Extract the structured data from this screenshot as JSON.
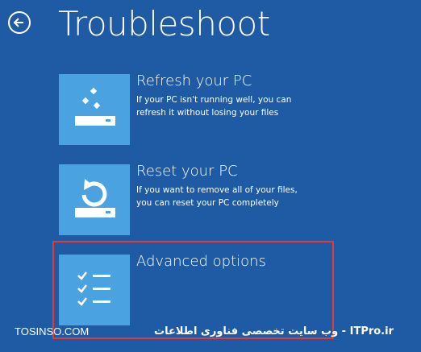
{
  "header": {
    "title": "Troubleshoot",
    "back_icon": "back-arrow-icon"
  },
  "options": [
    {
      "title": "Refresh your PC",
      "description": "If your PC isn't running well, you can refresh it without losing your files",
      "icon": "refresh-pc-icon"
    },
    {
      "title": "Reset your PC",
      "description": "If you want to remove all of your files, you can reset your PC completely",
      "icon": "reset-pc-icon"
    },
    {
      "title": "Advanced options",
      "description": "",
      "icon": "checklist-icon"
    }
  ],
  "watermark": {
    "left": "TOSINSO.COM",
    "right": "ITPro.ir - وب سایت تخصصی فناوری اطلاعات"
  },
  "colors": {
    "background": "#1f5ba5",
    "tile": "#4aa3e0",
    "highlight": "#e53935"
  }
}
